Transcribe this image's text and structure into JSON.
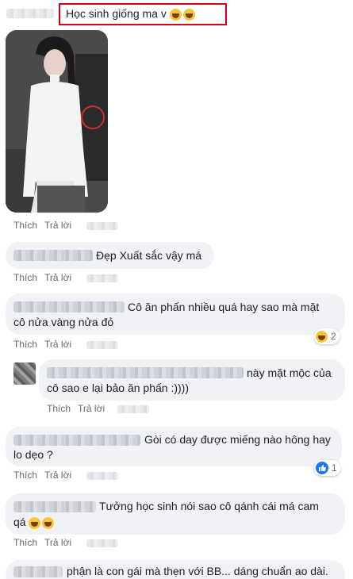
{
  "comments": [
    {
      "text": "Học sinh giống ma v",
      "actions": {
        "like": "Thích",
        "reply": "Trả lời"
      }
    },
    {
      "text": "Đẹp Xuất sắc vậy má",
      "actions": {
        "like": "Thích",
        "reply": "Trả lời"
      }
    },
    {
      "text_line1": "Cô ăn phấn nhiều quá hay sao mà mặt",
      "text_line2": "cô nửa vàng nửa đỏ",
      "actions": {
        "like": "Thích",
        "reply": "Trả lời"
      },
      "reaction_count": "2"
    },
    {
      "text_line1": "này mặt mộc của",
      "text_line2": "cô sao e lại bảo ăn phấn :))))",
      "actions": {
        "like": "Thích",
        "reply": "Trả lời"
      }
    },
    {
      "text_line1": "Gòi có day được miếng nào hông hay",
      "text_line2": "lo dẹo ?",
      "actions": {
        "like": "Thích",
        "reply": "Trả lời"
      },
      "reaction_count": "1"
    },
    {
      "text_line1": "Tưởng học sinh nói sao cô qánh cái má cam",
      "text_line2": "qá",
      "actions": {
        "like": "Thích",
        "reply": "Trả lời"
      }
    },
    {
      "text": "phận là con gái mà thẹn với BB... dáng chuẩn ao dài."
    }
  ],
  "colors": {
    "highlight": "#d0021b",
    "link": "#65676b",
    "bubble": "#f0f2f5",
    "like": "#1877f2"
  }
}
